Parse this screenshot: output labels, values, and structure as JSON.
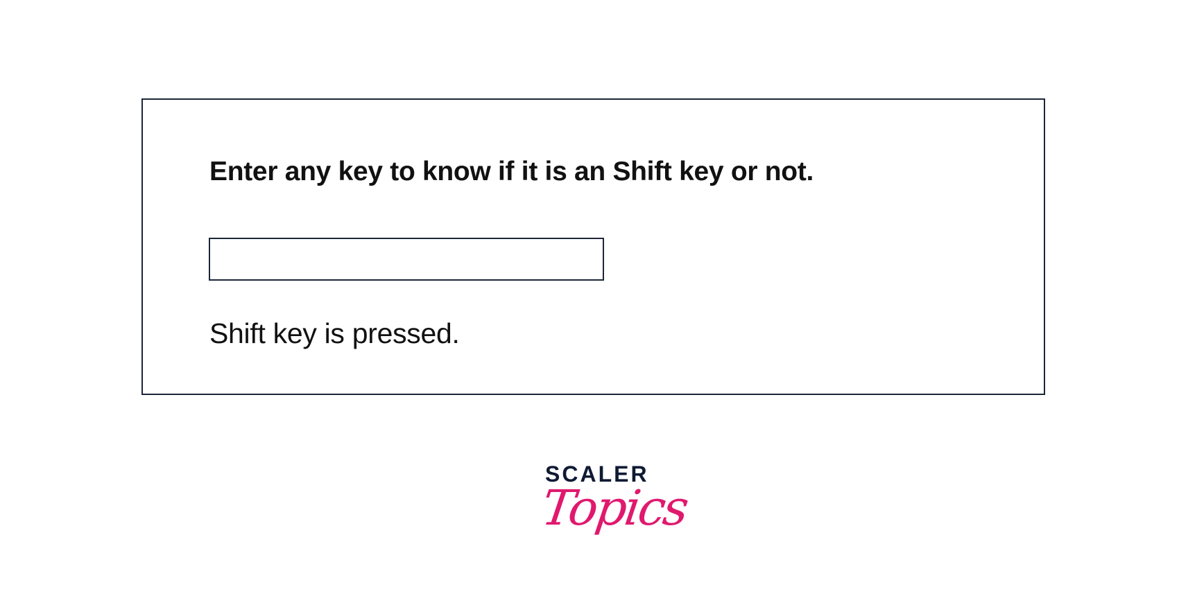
{
  "demo": {
    "prompt": "Enter any key to know if it is an Shift key or not.",
    "input_value": "",
    "input_placeholder": "",
    "result": "Shift key is pressed."
  },
  "logo": {
    "brand_top": "SCALER",
    "brand_bottom": "Topics",
    "top_color": "#0f1a33",
    "bottom_color": "#e0196e"
  }
}
